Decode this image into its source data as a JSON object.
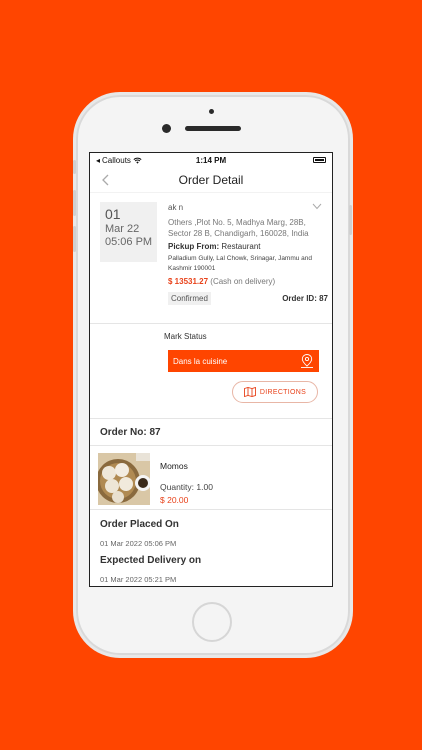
{
  "status_bar": {
    "carrier": "Callouts",
    "time": "1:14 PM"
  },
  "nav": {
    "title": "Order Detail"
  },
  "order": {
    "day": "01",
    "month_year": "Mar 22",
    "time": "05:06 PM",
    "customer": "ak n",
    "address": "Others ,Plot No. 5, Madhya Marg, 28B, Sector 28 B, Chandigarh, 160028, India",
    "pickup_label": "Pickup From:",
    "pickup_value": "Restaurant",
    "restaurant_address": "Palladium Gully, Lal Chowk, Srinagar, Jammu and Kashmir 190001",
    "price": "$ 13531.27",
    "payment": "(Cash on delivery)",
    "status": "Confirmed",
    "order_id": "Order ID: 87"
  },
  "mark_status": {
    "label": "Mark Status",
    "selected": "Dans la cuisine"
  },
  "directions": {
    "label": "DIRECTIONS"
  },
  "order_number": "Order No: 87",
  "item": {
    "name": "Momos",
    "quantity": "Quantity:  1.00",
    "price": "$ 20.00"
  },
  "placed": {
    "heading": "Order Placed On",
    "value": "01 Mar 2022 05:06 PM"
  },
  "expected": {
    "heading": "Expected Delivery on",
    "value": "01 Mar 2022 05:21 PM"
  },
  "colors": {
    "accent": "#FF4500",
    "price": "#e8421a"
  }
}
